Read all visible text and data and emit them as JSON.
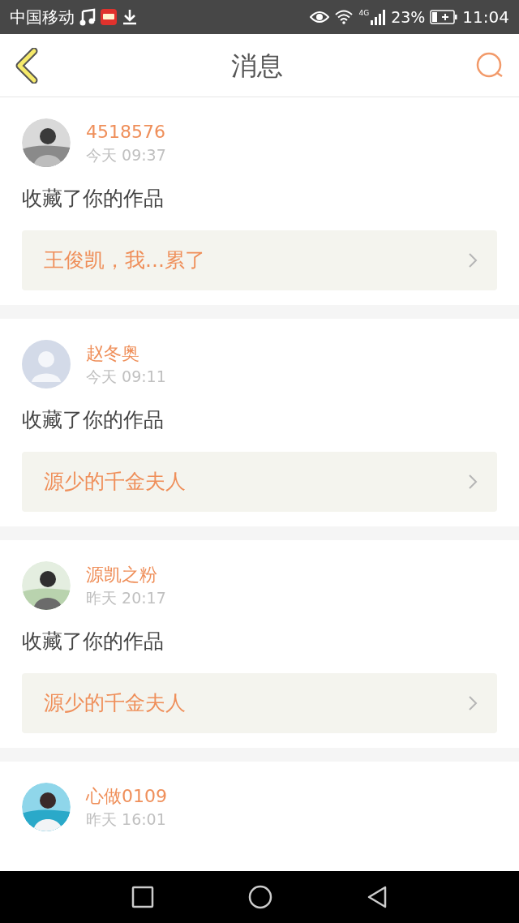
{
  "status_bar": {
    "carrier": "中国移动",
    "network": "4G",
    "battery": "23%",
    "time": "11:04"
  },
  "header": {
    "title": "消息"
  },
  "messages": [
    {
      "user": "4518576",
      "time": "今天 09:37",
      "action": "收藏了你的作品",
      "work": "王俊凯，我...累了"
    },
    {
      "user": "赵冬奥",
      "time": "今天 09:11",
      "action": "收藏了你的作品",
      "work": "源少的千金夫人",
      "avatar": {
        "kind": "default"
      }
    },
    {
      "user": "源凯之粉",
      "time": "昨天 20:17",
      "action": "收藏了你的作品",
      "work": "源少的千金夫人"
    },
    {
      "user": "心做0109",
      "time": "昨天 16:01"
    }
  ]
}
